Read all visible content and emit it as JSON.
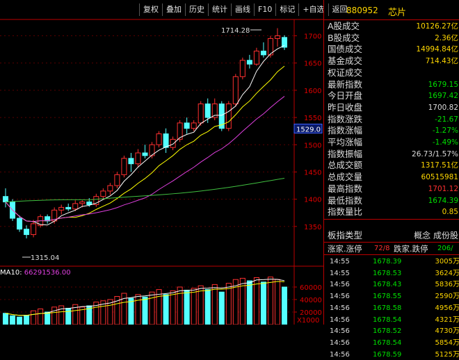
{
  "toolbar": [
    "复权",
    "叠加",
    "历史",
    "统计",
    "画线",
    "F10",
    "标记",
    "+自选",
    "返回"
  ],
  "stock": {
    "code": "880952",
    "name": "芯片"
  },
  "price_axis": [
    "1700",
    "1650",
    "1600",
    "1550",
    "1500",
    "1450",
    "1400",
    "1350"
  ],
  "current_price_tag": "1529.0",
  "high_label": "1714.28",
  "low_label": "1315.04",
  "volume_axis": [
    "60000",
    "40000",
    "20000"
  ],
  "volume_unit": "X1000",
  "ma10": {
    "label": "MA10:",
    "value": "66291536.00"
  },
  "quote_rows": [
    {
      "label": "A股成交",
      "value": "10126.27亿",
      "color": "#ffd700"
    },
    {
      "label": "B股成交",
      "value": "2.36亿",
      "color": "#ffd700"
    },
    {
      "label": "国债成交",
      "value": "14994.84亿",
      "color": "#ffd700"
    },
    {
      "label": "基金成交",
      "value": "714.43亿",
      "color": "#ffd700"
    },
    {
      "label": "权证成交",
      "value": "",
      "color": "#ffd700"
    },
    {
      "label": "最新指数",
      "value": "1679.15",
      "color": "#00e000"
    },
    {
      "label": "今日开盘",
      "value": "1697.42",
      "color": "#00e000"
    },
    {
      "label": "昨日收盘",
      "value": "1700.82",
      "color": "#dddddd"
    },
    {
      "label": "指数涨跌",
      "value": "-21.67",
      "color": "#00e000"
    },
    {
      "label": "指数涨幅",
      "value": "-1.27%",
      "color": "#00e000"
    },
    {
      "label": "平均涨幅",
      "value": "-1.49%",
      "color": "#00e000"
    },
    {
      "label": "指数振幅",
      "value": "26.73/1.57%",
      "color": "#dddddd"
    },
    {
      "label": "总成交额",
      "value": "1317.51亿",
      "color": "#ffd700"
    },
    {
      "label": "总成交量",
      "value": "60515981",
      "color": "#ffd700"
    },
    {
      "label": "最高指数",
      "value": "1701.12",
      "color": "#ff3030"
    },
    {
      "label": "最低指数",
      "value": "1674.39",
      "color": "#00e000"
    },
    {
      "label": "指数量比",
      "value": "0.85",
      "color": "#ffd700"
    }
  ],
  "board": {
    "label": "板指类型",
    "value": "概念 成份股"
  },
  "updown": {
    "up_label": "涨家.涨停",
    "up_value": "72/8",
    "down_label": "跌家.跌停",
    "down_value": "206/"
  },
  "ticks": [
    {
      "time": "14:55",
      "price": "1678.39",
      "vol": "3005万"
    },
    {
      "time": "14:55",
      "price": "1678.53",
      "vol": "3624万"
    },
    {
      "time": "14:56",
      "price": "1678.43",
      "vol": "5836万"
    },
    {
      "time": "14:56",
      "price": "1678.55",
      "vol": "2590万"
    },
    {
      "time": "14:56",
      "price": "1678.58",
      "vol": "4956万"
    },
    {
      "time": "14:56",
      "price": "1678.54",
      "vol": "4321万"
    },
    {
      "time": "14:56",
      "price": "1678.52",
      "vol": "4730万"
    },
    {
      "time": "14:56",
      "price": "1678.54",
      "vol": "5854万"
    },
    {
      "time": "14:56",
      "price": "1678.59",
      "vol": "5125万"
    }
  ],
  "chart_data": {
    "type": "candlestick",
    "ylim": [
      1300,
      1730
    ],
    "candles": [
      [
        1405,
        1420,
        1385,
        1395
      ],
      [
        1395,
        1400,
        1360,
        1365
      ],
      [
        1365,
        1370,
        1340,
        1345
      ],
      [
        1345,
        1352,
        1328,
        1335
      ],
      [
        1335,
        1362,
        1330,
        1355
      ],
      [
        1352,
        1372,
        1348,
        1368
      ],
      [
        1368,
        1372,
        1355,
        1360
      ],
      [
        1360,
        1385,
        1355,
        1380
      ],
      [
        1380,
        1390,
        1372,
        1385
      ],
      [
        1385,
        1392,
        1378,
        1382
      ],
      [
        1382,
        1398,
        1378,
        1392
      ],
      [
        1392,
        1398,
        1385,
        1395
      ],
      [
        1395,
        1402,
        1386,
        1390
      ],
      [
        1390,
        1410,
        1386,
        1405
      ],
      [
        1405,
        1420,
        1400,
        1415
      ],
      [
        1415,
        1430,
        1408,
        1425
      ],
      [
        1425,
        1450,
        1420,
        1445
      ],
      [
        1445,
        1480,
        1440,
        1475
      ],
      [
        1475,
        1485,
        1450,
        1465
      ],
      [
        1465,
        1492,
        1460,
        1485
      ],
      [
        1485,
        1500,
        1475,
        1480
      ],
      [
        1480,
        1505,
        1475,
        1500
      ],
      [
        1500,
        1525,
        1495,
        1520
      ],
      [
        1520,
        1530,
        1485,
        1495
      ],
      [
        1495,
        1515,
        1490,
        1510
      ],
      [
        1510,
        1545,
        1505,
        1540
      ],
      [
        1540,
        1550,
        1520,
        1530
      ],
      [
        1530,
        1545,
        1525,
        1540
      ],
      [
        1540,
        1580,
        1535,
        1575
      ],
      [
        1575,
        1585,
        1540,
        1550
      ],
      [
        1550,
        1585,
        1545,
        1575
      ],
      [
        1575,
        1580,
        1525,
        1530
      ],
      [
        1530,
        1580,
        1525,
        1575
      ],
      [
        1575,
        1630,
        1570,
        1625
      ],
      [
        1625,
        1660,
        1620,
        1655
      ],
      [
        1655,
        1665,
        1640,
        1648
      ],
      [
        1648,
        1678,
        1645,
        1672
      ],
      [
        1672,
        1688,
        1660,
        1665
      ],
      [
        1665,
        1700,
        1660,
        1695
      ],
      [
        1695,
        1714,
        1680,
        1700
      ],
      [
        1697,
        1701,
        1674,
        1679
      ]
    ],
    "volume": {
      "ylim": [
        0,
        80000
      ],
      "values": [
        18000,
        14000,
        12000,
        15000,
        22000,
        25000,
        20000,
        28000,
        30000,
        26000,
        32000,
        28000,
        30000,
        36000,
        38000,
        40000,
        45000,
        50000,
        42000,
        48000,
        44000,
        52000,
        56000,
        48000,
        54000,
        60000,
        55000,
        58000,
        62000,
        56000,
        64000,
        52000,
        66000,
        72000,
        74000,
        70000,
        75000,
        68000,
        76000,
        72000,
        60000
      ]
    }
  }
}
